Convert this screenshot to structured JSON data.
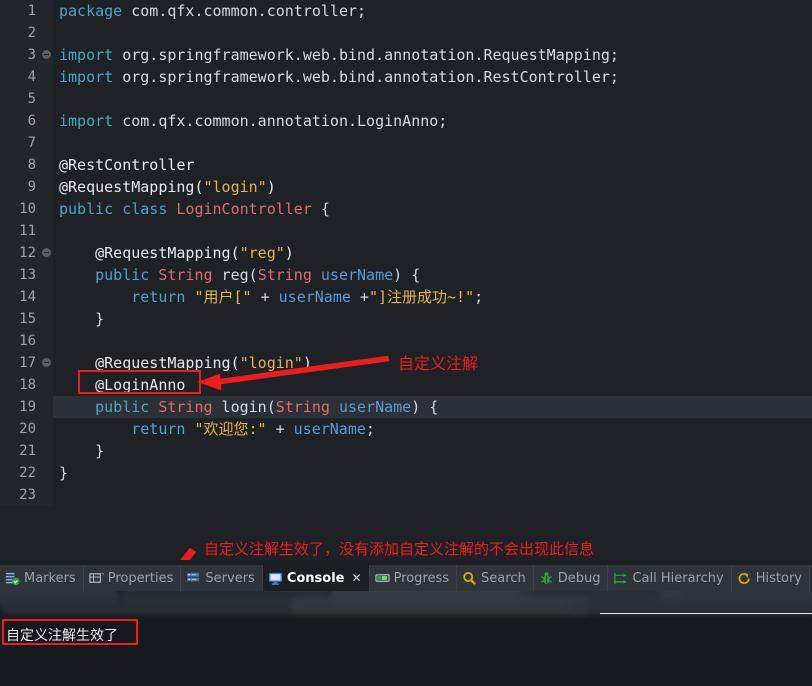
{
  "editor": {
    "language": "java",
    "theme_background": "#1e2227",
    "gutter_background": "#22262b",
    "current_line": 19,
    "changed_lines": [
      17,
      18,
      19,
      20,
      21
    ],
    "fold_lines": [
      3,
      12,
      17
    ],
    "lines": [
      {
        "n": "1",
        "tokens": [
          {
            "t": "kw",
            "s": "package"
          },
          {
            "t": "plain",
            "s": " "
          },
          {
            "t": "plain",
            "s": "com.qfx.common.controller;"
          }
        ]
      },
      {
        "n": "2",
        "tokens": []
      },
      {
        "n": "3",
        "tokens": [
          {
            "t": "kw",
            "s": "import"
          },
          {
            "t": "plain",
            "s": " org.springframework.web.bind.annotation.RequestMapping;"
          }
        ]
      },
      {
        "n": "4",
        "tokens": [
          {
            "t": "kw",
            "s": "import"
          },
          {
            "t": "plain",
            "s": " org.springframework.web.bind.annotation.RestController;"
          }
        ]
      },
      {
        "n": "5",
        "tokens": []
      },
      {
        "n": "6",
        "tokens": [
          {
            "t": "kw",
            "s": "import"
          },
          {
            "t": "plain",
            "s": " com.qfx.common.annotation.LoginAnno;"
          }
        ]
      },
      {
        "n": "7",
        "tokens": []
      },
      {
        "n": "8",
        "tokens": [
          {
            "t": "anno",
            "s": "@RestController"
          }
        ]
      },
      {
        "n": "9",
        "tokens": [
          {
            "t": "anno",
            "s": "@RequestMapping("
          },
          {
            "t": "str",
            "s": "\"login\""
          },
          {
            "t": "anno",
            "s": ")"
          }
        ]
      },
      {
        "n": "10",
        "tokens": [
          {
            "t": "kw",
            "s": "public"
          },
          {
            "t": "plain",
            "s": " "
          },
          {
            "t": "kw",
            "s": "class"
          },
          {
            "t": "plain",
            "s": " "
          },
          {
            "t": "type",
            "s": "LoginController"
          },
          {
            "t": "plain",
            "s": " {"
          }
        ]
      },
      {
        "n": "11",
        "tokens": []
      },
      {
        "n": "12",
        "tokens": [
          {
            "t": "plain",
            "s": "    "
          },
          {
            "t": "anno",
            "s": "@RequestMapping("
          },
          {
            "t": "str",
            "s": "\"reg\""
          },
          {
            "t": "anno",
            "s": ")"
          }
        ]
      },
      {
        "n": "13",
        "tokens": [
          {
            "t": "plain",
            "s": "    "
          },
          {
            "t": "kw",
            "s": "public"
          },
          {
            "t": "plain",
            "s": " "
          },
          {
            "t": "type",
            "s": "String"
          },
          {
            "t": "plain",
            "s": " reg("
          },
          {
            "t": "type",
            "s": "String"
          },
          {
            "t": "plain",
            "s": " "
          },
          {
            "t": "ident",
            "s": "userName"
          },
          {
            "t": "plain",
            "s": ") {"
          }
        ]
      },
      {
        "n": "14",
        "tokens": [
          {
            "t": "plain",
            "s": "        "
          },
          {
            "t": "kw",
            "s": "return"
          },
          {
            "t": "plain",
            "s": " "
          },
          {
            "t": "str",
            "s": "\"用户[\""
          },
          {
            "t": "plain",
            "s": " + "
          },
          {
            "t": "ident",
            "s": "userName"
          },
          {
            "t": "plain",
            "s": " +"
          },
          {
            "t": "str",
            "s": "\"]注册成功~!\""
          },
          {
            "t": "plain",
            "s": ";"
          }
        ]
      },
      {
        "n": "15",
        "tokens": [
          {
            "t": "plain",
            "s": "    }"
          }
        ]
      },
      {
        "n": "16",
        "tokens": []
      },
      {
        "n": "17",
        "tokens": [
          {
            "t": "plain",
            "s": "    "
          },
          {
            "t": "anno",
            "s": "@RequestMapping("
          },
          {
            "t": "str",
            "s": "\"login\""
          },
          {
            "t": "anno",
            "s": ")"
          }
        ]
      },
      {
        "n": "18",
        "tokens": [
          {
            "t": "plain",
            "s": "    "
          },
          {
            "t": "anno",
            "s": "@LoginAnno"
          }
        ]
      },
      {
        "n": "19",
        "tokens": [
          {
            "t": "plain",
            "s": "    "
          },
          {
            "t": "kw",
            "s": "public"
          },
          {
            "t": "plain",
            "s": " "
          },
          {
            "t": "type",
            "s": "String"
          },
          {
            "t": "plain",
            "s": " login("
          },
          {
            "t": "type",
            "s": "String"
          },
          {
            "t": "plain",
            "s": " "
          },
          {
            "t": "ident",
            "s": "userName"
          },
          {
            "t": "plain",
            "s": ") {"
          }
        ]
      },
      {
        "n": "20",
        "tokens": [
          {
            "t": "plain",
            "s": "        "
          },
          {
            "t": "kw",
            "s": "return"
          },
          {
            "t": "plain",
            "s": " "
          },
          {
            "t": "str",
            "s": "\"欢迎您:\""
          },
          {
            "t": "plain",
            "s": " + "
          },
          {
            "t": "ident",
            "s": "userName"
          },
          {
            "t": "plain",
            "s": ";"
          }
        ]
      },
      {
        "n": "21",
        "tokens": [
          {
            "t": "plain",
            "s": "    }"
          }
        ]
      },
      {
        "n": "22",
        "tokens": [
          {
            "t": "plain",
            "s": "}"
          }
        ]
      },
      {
        "n": "23",
        "tokens": []
      }
    ]
  },
  "annotations": {
    "color": "#ee1c1c",
    "code_label": "自定义注解",
    "console_label": "自定义注解生效了，没有添加自定义注解的不会出现此信息"
  },
  "bottom_panel": {
    "tabs": [
      {
        "label": "Markers",
        "icon": "markers-icon",
        "active": false
      },
      {
        "label": "Properties",
        "icon": "properties-icon",
        "active": false
      },
      {
        "label": "Servers",
        "icon": "servers-icon",
        "active": false
      },
      {
        "label": "Console",
        "icon": "console-icon",
        "active": true,
        "close": "✕"
      },
      {
        "label": "Progress",
        "icon": "progress-icon",
        "active": false
      },
      {
        "label": "Search",
        "icon": "search-icon",
        "active": false
      },
      {
        "label": "Debug",
        "icon": "debug-icon",
        "active": false
      },
      {
        "label": "Call Hierarchy",
        "icon": "call-hierarchy-icon",
        "active": false
      },
      {
        "label": "History",
        "icon": "history-icon",
        "active": false
      }
    ],
    "console_output": "自定义注解生效了"
  }
}
